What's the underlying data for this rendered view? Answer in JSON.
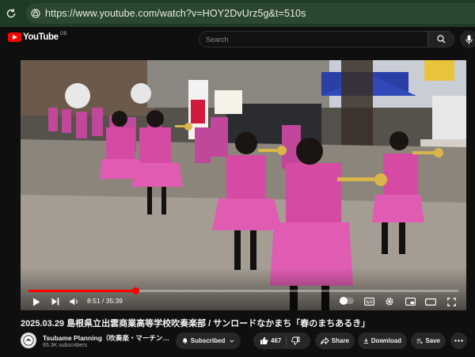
{
  "browser": {
    "url": "https://www.youtube.com/watch?v=HOY2DvUrz5g&t=510s"
  },
  "header": {
    "logo_text": "YouTube",
    "region": "GB",
    "search_placeholder": "Search"
  },
  "player": {
    "current_time": "8:51",
    "duration": "35:39",
    "time_display": "8:51 / 35:39",
    "progress_fraction": 0.248
  },
  "video": {
    "title": "2025.03.29 島根県立出雲商業高等学校吹奏楽部 / サンロードなかまち「春のまちあるき」"
  },
  "channel": {
    "name": "Tsubame Planning（吹奏楽・マーチン…",
    "subscribers": "65.3K subscribers"
  },
  "actions": {
    "subscribed_label": "Subscribed",
    "like_count": "467",
    "share_label": "Share",
    "download_label": "Download",
    "save_label": "Save"
  },
  "colors": {
    "accent": "#ff0000",
    "chrome_bar": "#1f3b25",
    "background": "#0f0f0f"
  }
}
